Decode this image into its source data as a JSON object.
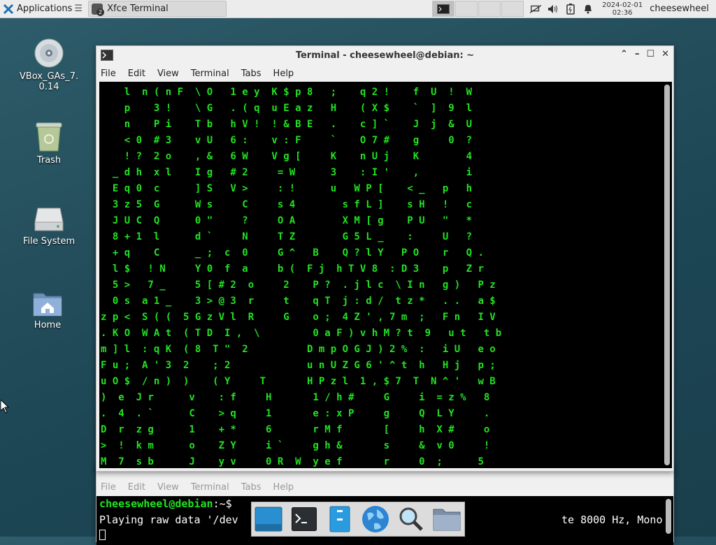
{
  "panel": {
    "applications_label": "Applications",
    "task_label": "Xfce Terminal",
    "task_badge": "2",
    "clock_date": "2024-02-01",
    "clock_time": "02:36",
    "user": "cheesewheel"
  },
  "desktop": {
    "icons": [
      {
        "label": "VBox_GAs_7.\n0.14"
      },
      {
        "label": "Trash"
      },
      {
        "label": "File System"
      },
      {
        "label": "Home"
      }
    ]
  },
  "terminal_main": {
    "title": "Terminal - cheesewheel@debian: ~",
    "menu": [
      "File",
      "Edit",
      "View",
      "Terminal",
      "Tabs",
      "Help"
    ]
  },
  "terminal_back": {
    "menu": [
      "File",
      "Edit",
      "View",
      "Terminal",
      "Tabs",
      "Help"
    ],
    "prompt_user": "cheesewheel@debian",
    "prompt_rest": ":~$",
    "line2": "Playing raw data '/dev",
    "line2_tail": "te 8000 Hz, Mono"
  },
  "matrix_rows": [
    "    l  n ( n F  \\ O   1 e y  K $ p 8   ;    q 2 !    f  U  !  W",
    "    p    3 !    \\ G   . ( q  u E a z   H    ( X $    `  ]  9  l",
    "    n    P i    T b   h V !  ! & B E   .    c ] `    J  j  &  U",
    "    < 0  # 3    v U   6 :    v : F     `    O 7 #    g     0  ?",
    "    ! ?  2 o    , &   6 W    V g [     K    n U j    K        4",
    "  _ d h  x l    I g   # 2     = W      3    : I '    ,        i",
    "  E q 0  c      ] S   V >     : !      u   W P [    < _   p   h",
    "  3 z 5  G      W s     C     s 4        s f L ]    s H   !   c",
    "  J U C  Q      0 \"     ?     O A        X M [ g    P U   \"   *",
    "  8 + 1  l      d `     N     T Z        G 5 L _    :     U   ?",
    "  + q    C      _ ;  c  0     G ^   B    Q ? l Y   P O    r   Q .",
    "  l $   ! N     Y 0  f  a     b (  F j  h T V 8  : D 3    p   Z r",
    "  5 >   7 _     5 [ # 2  o     2    P ?  . j l c  \\ I n   g )   P z",
    "  0 s  a 1 _    3 > @ 3  r     t    q T  j : d /  t z *   . .   a $",
    "z p <  S ( (  5 G z V l  R     G    o ;  4 Z ' , 7 m  ;   F n   I V",
    ". K O  W A t  ( T D  I ,  \\         0 a F ) v h M ? t  9   u t   t b",
    "m ] l  : q K  ( 8  T \"  2          D m p O G J ) 2 %  :   i U   e o",
    "F u ;  A ' 3  2    ; 2             u n U Z G 6 ' ^ t  h   H j   p ;",
    "u O $  / n )  )    ( Y     T       H P z l  1 , $ 7  T  N ^ '   w B",
    ")  e  J r      v    : f     H       1 / h #     G     i  = z %   8",
    ".  4  . `      C    > q     1       e : x P     g     Q  L Y     .",
    "D  r  z g      1    + *     6       r M f       [     h  X #     o",
    ">  !  k m      o    Z Y     i `     g h &       s     &  v 0     !",
    "M  7  s b      J    y v     0 R  W  y e f       r     0  ;      5"
  ]
}
